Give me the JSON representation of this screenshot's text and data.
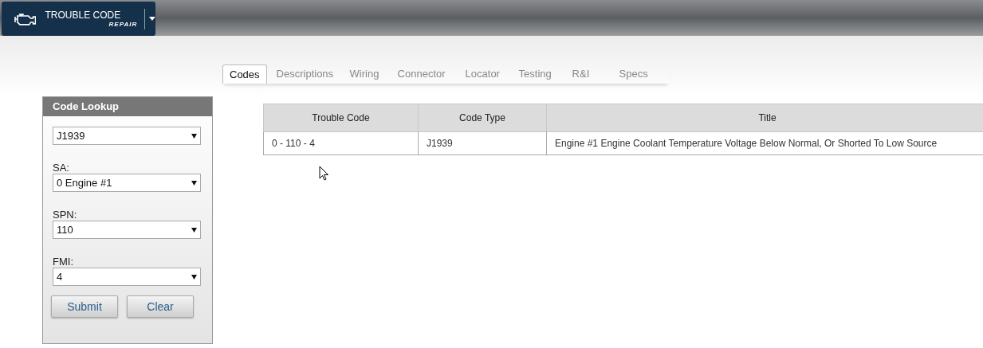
{
  "app_button": {
    "title": "TROUBLE CODE",
    "subtitle": "REPAIR"
  },
  "tabs": [
    {
      "label": "Codes",
      "selected": true
    },
    {
      "label": "Descriptions",
      "selected": false
    },
    {
      "label": "Wiring",
      "selected": false
    },
    {
      "label": "Connector",
      "selected": false
    },
    {
      "label": "Locator",
      "selected": false
    },
    {
      "label": "Testing",
      "selected": false
    },
    {
      "label": "R&I",
      "selected": false
    },
    {
      "label": "Specs",
      "selected": false
    }
  ],
  "code_lookup": {
    "title": "Code Lookup",
    "fields": [
      {
        "value": "J1939"
      },
      {
        "label": "SA:",
        "value": "0 Engine #1"
      },
      {
        "label": "SPN:",
        "value": "110"
      },
      {
        "label": "FMI:",
        "value": "4"
      }
    ],
    "buttons": [
      "Submit",
      "Clear"
    ]
  },
  "table": {
    "columns": [
      "Trouble Code",
      "Code Type",
      "Title"
    ],
    "rows": [
      [
        "0 - 110 - 4",
        "J1939",
        "Engine #1 Engine Coolant Temperature Voltage Below Normal, Or Shorted To Low Source"
      ]
    ]
  }
}
